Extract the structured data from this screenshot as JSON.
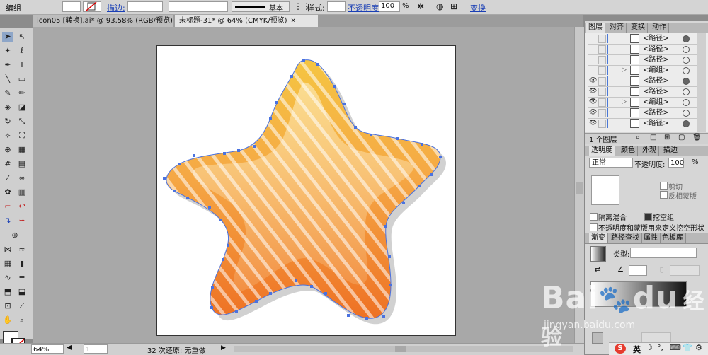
{
  "control_bar": {
    "selection_label": "编组",
    "stroke_label": "描边:",
    "stroke_profile": "基本",
    "style_label": "样式:",
    "opacity_label": "不透明度:",
    "opacity_value": "100",
    "opacity_unit": "%",
    "transform_label": "变换"
  },
  "tabs": [
    {
      "label": "icon05 [转换].ai* @ 93.58% (RGB/预览)",
      "active": false
    },
    {
      "label": "未标题-31* @ 64% (CMYK/预览)",
      "active": true
    }
  ],
  "status": {
    "zoom": "64%",
    "artboard_index": "1",
    "undo_text": "32 次还原: 无重做"
  },
  "layers_panel": {
    "tabs": [
      "图层",
      "对齐",
      "变换",
      "动作"
    ],
    "rows": [
      {
        "name": "<路径>",
        "visible": false,
        "group": false,
        "target_filled": true
      },
      {
        "name": "<路径>",
        "visible": false,
        "group": false,
        "target_filled": false
      },
      {
        "name": "<路径>",
        "visible": false,
        "group": false,
        "target_filled": false
      },
      {
        "name": "<编组>",
        "visible": false,
        "group": true,
        "target_filled": false
      },
      {
        "name": "<路径>",
        "visible": true,
        "group": false,
        "target_filled": true
      },
      {
        "name": "<路径>",
        "visible": true,
        "group": false,
        "target_filled": false
      },
      {
        "name": "<编组>",
        "visible": true,
        "group": true,
        "target_filled": false
      },
      {
        "name": "<路径>",
        "visible": true,
        "group": false,
        "target_filled": false
      },
      {
        "name": "<路径>",
        "visible": true,
        "group": false,
        "target_filled": true
      }
    ],
    "footer": "1 个图层"
  },
  "transparency_panel": {
    "tabs": [
      "透明度",
      "颜色",
      "外观",
      "描边"
    ],
    "blend_mode": "正常",
    "opacity_label": "不透明度:",
    "opacity_value": "100",
    "opacity_unit": "%",
    "clip_label": "剪切",
    "invert_mask_label": "反相蒙版",
    "isolate_blending_label": "隔离混合",
    "knockout_group_label": "挖空组",
    "opacity_mask_label": "不透明度和蒙版用来定义挖空形状"
  },
  "gradient_panel": {
    "tabs": [
      "渐变",
      "路径查找",
      "属性",
      "色板库"
    ],
    "type_label": "类型:"
  },
  "watermark": {
    "brand": "Bai",
    "brand2": "du",
    "sub": "经验",
    "url": "jingyan.baidu.com"
  },
  "ime": {
    "label": "英"
  },
  "colors": {
    "star_top": "#f2b73a",
    "star_bottom": "#ee7a26",
    "anchor": "#4a72e0",
    "accent_blue": "#1a3fb5"
  }
}
